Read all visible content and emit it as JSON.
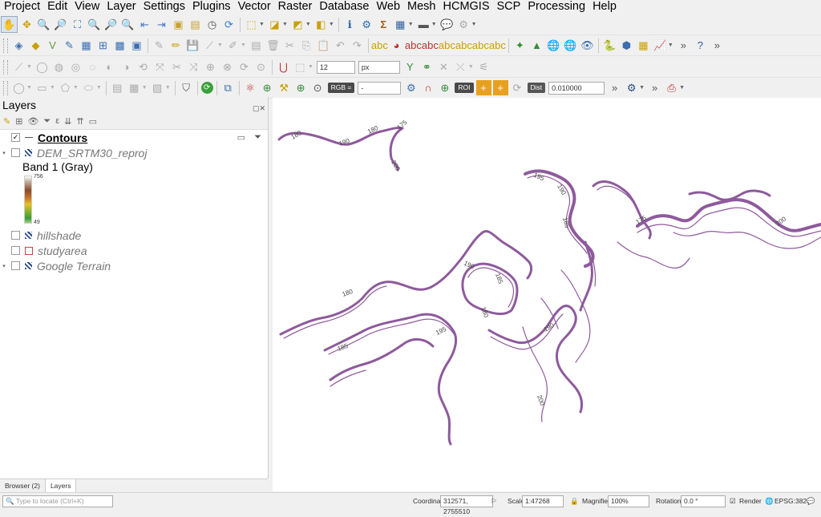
{
  "menu": [
    "Project",
    "Edit",
    "View",
    "Layer",
    "Settings",
    "Plugins",
    "Vector",
    "Raster",
    "Database",
    "Web",
    "Mesh",
    "HCMGIS",
    "SCP",
    "Processing",
    "Help"
  ],
  "toolbar4": {
    "snap_tolerance": "12",
    "snap_units": "px"
  },
  "toolbar5": {
    "rgb_label": "RGB =",
    "rgb_value": "-",
    "roi_label": "ROI",
    "dist_label": "Dist",
    "dist_value": "0.010000"
  },
  "panel": {
    "title": "Layers",
    "layers": [
      {
        "name": "Contours",
        "checked": true,
        "style": "bold"
      },
      {
        "name": "DEM_SRTM30_reproj",
        "checked": false,
        "style": "italic"
      },
      {
        "name": "hillshade",
        "checked": false,
        "style": "italic"
      },
      {
        "name": "studyarea",
        "checked": false,
        "style": "italic"
      },
      {
        "name": "Google Terrain",
        "checked": false,
        "style": "italic"
      }
    ],
    "band_label": "Band 1 (Gray)",
    "ramp_max": "756",
    "ramp_min": "49",
    "tabs": [
      "Browser (2)",
      "Layers"
    ]
  },
  "contour_color": "#8e5a9c",
  "contour_labels": [
    "180",
    "190",
    "180",
    "175",
    "200",
    "195",
    "190",
    "185",
    "175",
    "200",
    "180",
    "190",
    "185",
    "180",
    "195",
    "185",
    "190",
    "200"
  ],
  "status": {
    "locate_placeholder": "Type to locate (Ctrl+K)",
    "coordinate_label": "Coordinate",
    "coordinate_value": "312571, 2755510",
    "scale_label": "Scale",
    "scale_value": "1:47268",
    "magnifier_label": "Magnifier",
    "magnifier_value": "100%",
    "rotation_label": "Rotation",
    "rotation_value": "0.0 °",
    "render_label": "Render",
    "crs": "EPSG:3826"
  }
}
